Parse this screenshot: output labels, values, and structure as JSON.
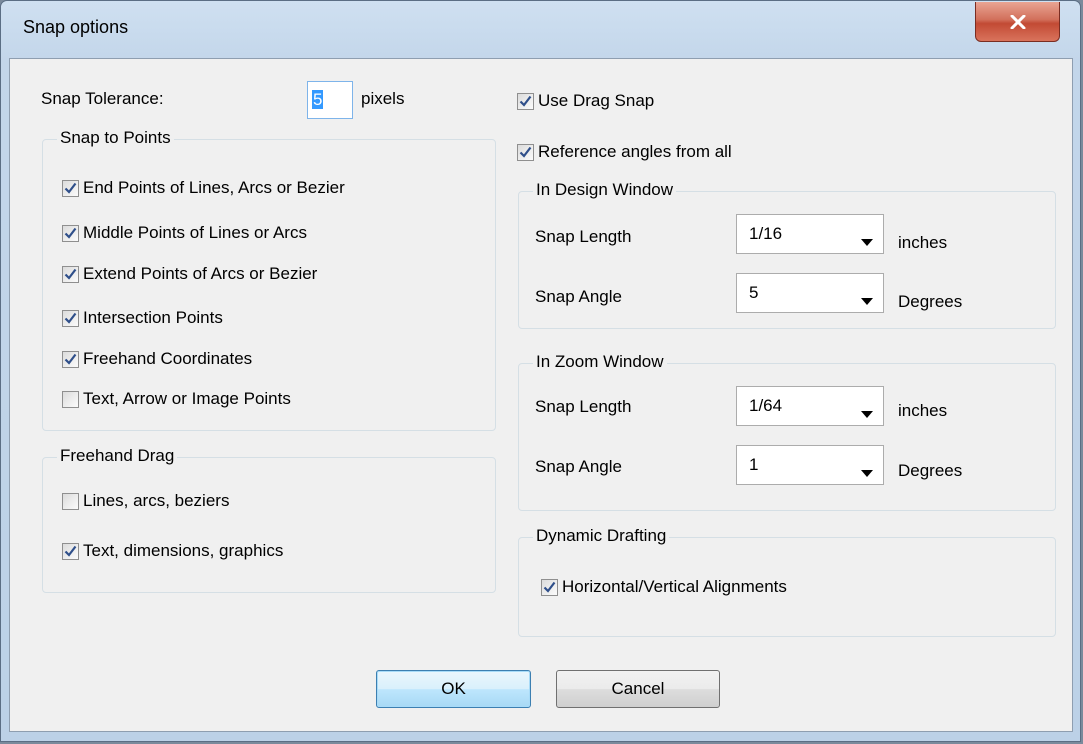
{
  "window": {
    "title": "Snap options"
  },
  "tolerance": {
    "label": "Snap Tolerance:",
    "value": "5",
    "unit": "pixels"
  },
  "snap_points": {
    "title": "Snap to Points",
    "items": [
      {
        "label": "End Points of Lines, Arcs or Bezier",
        "checked": true
      },
      {
        "label": "Middle Points of Lines or Arcs",
        "checked": true
      },
      {
        "label": "Extend Points of Arcs or Bezier",
        "checked": true
      },
      {
        "label": "Intersection Points",
        "checked": true
      },
      {
        "label": "Freehand Coordinates",
        "checked": true
      },
      {
        "label": "Text, Arrow or Image Points",
        "checked": false
      }
    ]
  },
  "freehand_drag": {
    "title": "Freehand Drag",
    "items": [
      {
        "label": "Lines, arcs, beziers",
        "checked": false
      },
      {
        "label": "Text, dimensions, graphics",
        "checked": true
      }
    ]
  },
  "use_drag_snap": {
    "label": "Use Drag Snap",
    "checked": true
  },
  "reference_angles": {
    "label": "Reference angles from all",
    "checked": true
  },
  "design_window": {
    "title": "In Design Window",
    "snap_length_label": "Snap Length",
    "snap_length_value": "1/16",
    "snap_length_unit": "inches",
    "snap_angle_label": "Snap Angle",
    "snap_angle_value": "5",
    "snap_angle_unit": "Degrees"
  },
  "zoom_window": {
    "title": "In Zoom Window",
    "snap_length_label": "Snap Length",
    "snap_length_value": "1/64",
    "snap_length_unit": "inches",
    "snap_angle_label": "Snap Angle",
    "snap_angle_value": "1",
    "snap_angle_unit": "Degrees"
  },
  "dynamic_drafting": {
    "title": "Dynamic Drafting",
    "items": [
      {
        "label": "Horizontal/Vertical Alignments",
        "checked": true
      }
    ]
  },
  "buttons": {
    "ok": "OK",
    "cancel": "Cancel"
  },
  "icons": {
    "close": "close-icon",
    "check": "checkmark-icon",
    "dropdown": "chevron-down-icon"
  },
  "colors": {
    "accent": "#3399ff",
    "close_button": "#c24a34",
    "checkmark": "#2f4f8a"
  }
}
